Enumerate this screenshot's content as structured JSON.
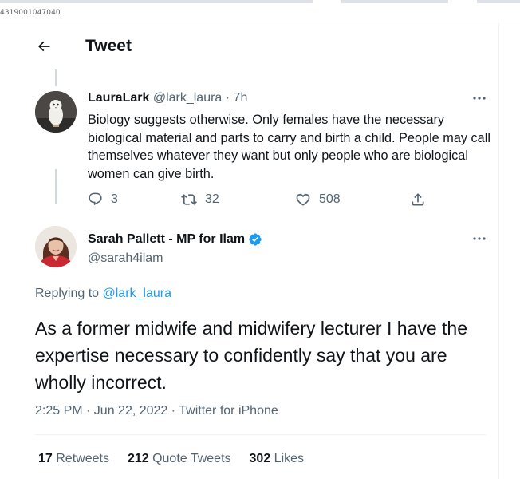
{
  "browser": {
    "url_fragment": "4319001047040"
  },
  "header": {
    "title": "Tweet"
  },
  "parent_tweet": {
    "name": "LauraLark",
    "handle": "@lark_laura",
    "separator": " · ",
    "time": "7h",
    "text": "Biology suggests otherwise.  Only females have the necessary biological material and parts to carry and birth a child.  People may call themselves whatever they want but only people who are biological women can give birth.",
    "replies": "3",
    "retweets": "32",
    "likes": "508"
  },
  "main_tweet": {
    "name": "Sarah Pallett - MP for Ilam",
    "handle": "@sarah4ilam",
    "replying_prefix": "Replying to ",
    "replying_to": "@lark_laura",
    "text": "As a former midwife and midwifery lecturer I have the expertise necessary to confidently say that you are wholly incorrect.",
    "timestamp": "2:25 PM · Jun 22, 2022 · Twitter for iPhone",
    "stats": {
      "retweets_count": "17",
      "retweets_label": " Retweets",
      "quotes_count": "212",
      "quotes_label": " Quote Tweets",
      "likes_count": "302",
      "likes_label": " Likes"
    }
  },
  "colors": {
    "accent": "#1d9bf0",
    "text_primary": "#0f1419",
    "text_secondary": "#536471",
    "divider": "#eff3f4",
    "verified": "#1d9bf0"
  },
  "icons": {
    "back": "arrow-left-icon",
    "more": "more-horizontal-icon",
    "reply": "reply-icon",
    "retweet": "retweet-icon",
    "like": "heart-icon",
    "share": "share-icon",
    "verified": "verified-badge-icon"
  }
}
